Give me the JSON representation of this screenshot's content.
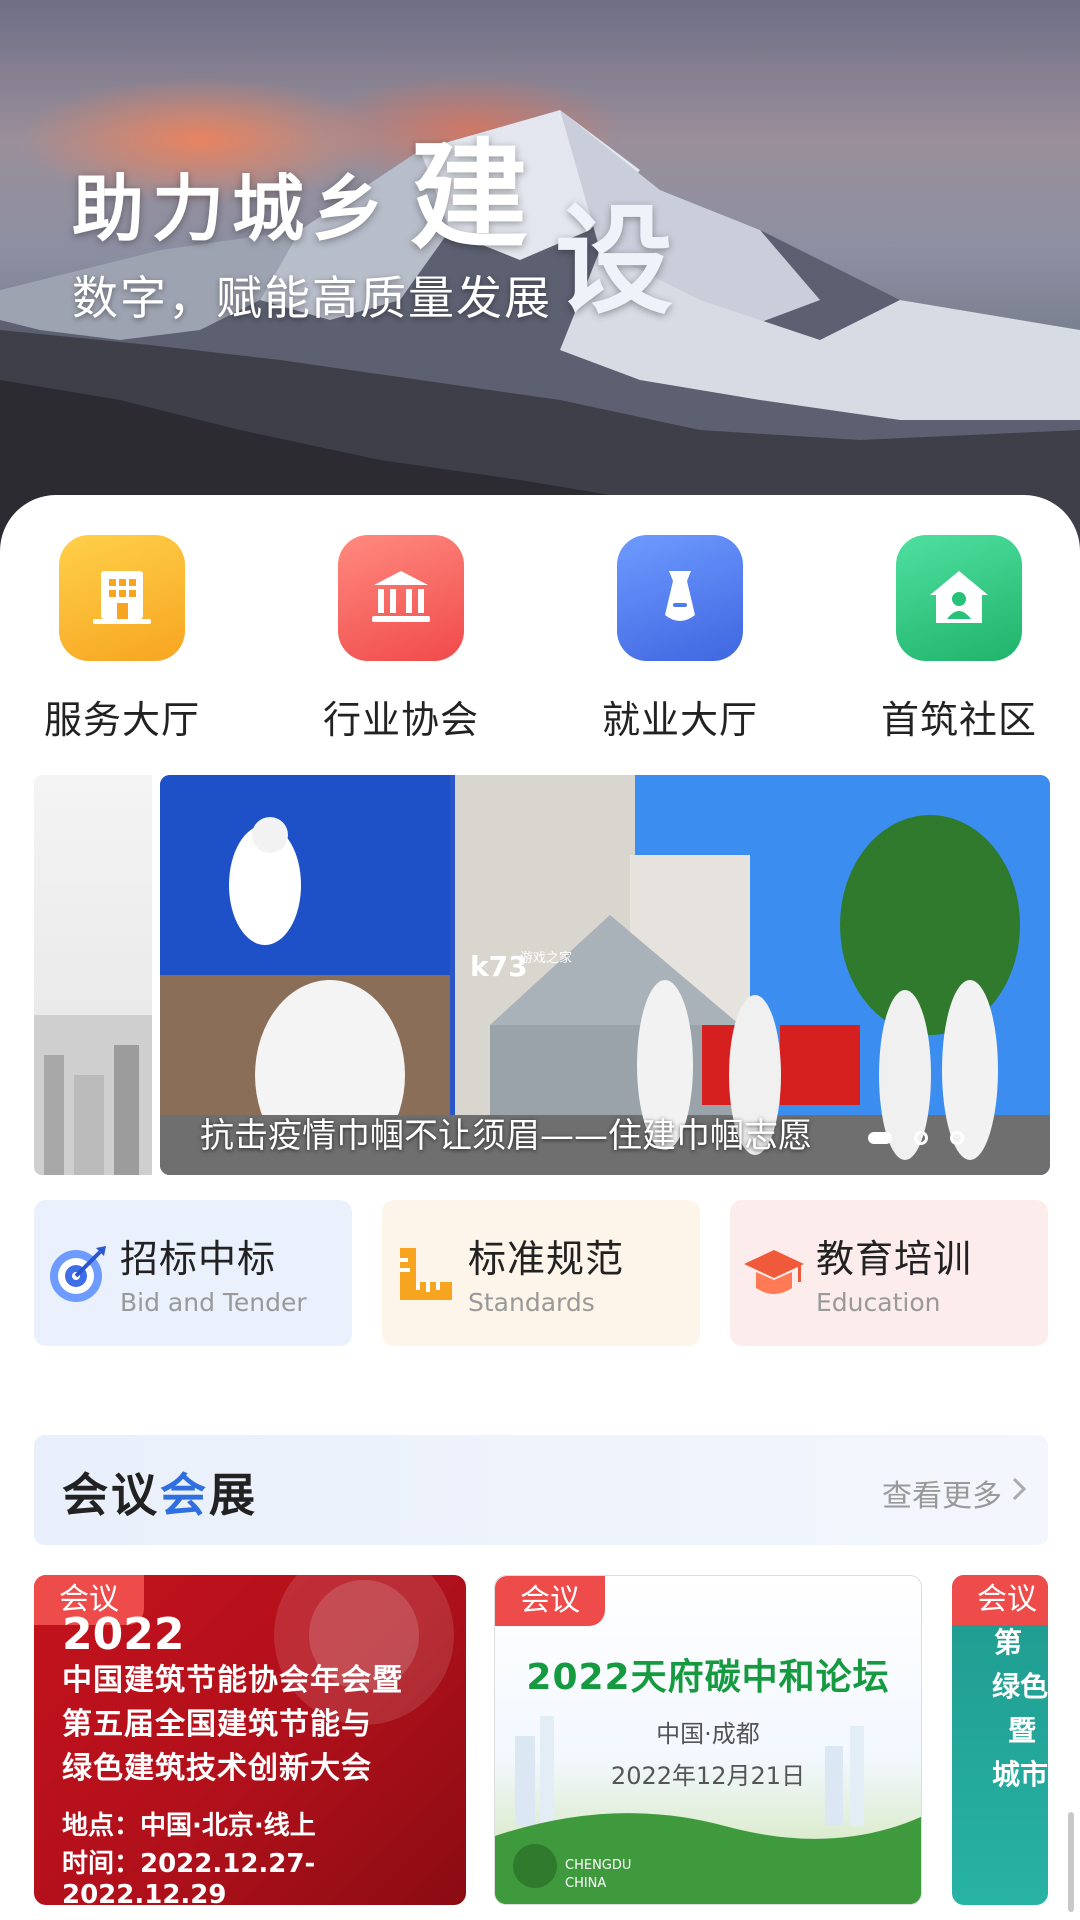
{
  "hero": {
    "title_part1": "助力城乡",
    "title_part2": "建",
    "title_part3": "设",
    "subtitle": "数字，赋能高质量发展"
  },
  "quick_nav": [
    {
      "label": "服务大厅",
      "icon": "building-icon",
      "color": "#f7a520"
    },
    {
      "label": "行业协会",
      "icon": "bank-icon",
      "color": "#f25a55"
    },
    {
      "label": "就业大厅",
      "icon": "tie-icon",
      "color": "#4d7cf0"
    },
    {
      "label": "首筑社区",
      "icon": "home-user-icon",
      "color": "#27c27a"
    }
  ],
  "banner": {
    "caption": "抗击疫情巾帼不让须眉——住建巾帼志愿",
    "watermark": "k73",
    "watermark_sub": "游戏之家",
    "dots_total": 3,
    "active_dot": 1
  },
  "features": [
    {
      "title": "招标中标",
      "subtitle": "Bid and Tender",
      "icon": "target-icon",
      "bg": "#eaf1fd"
    },
    {
      "title": "标准规范",
      "subtitle": "Standards",
      "icon": "ruler-icon",
      "bg": "#fdf4ea"
    },
    {
      "title": "教育培训",
      "subtitle": "Education",
      "icon": "graduation-cap-icon",
      "bg": "#fdecec"
    }
  ],
  "meetings_section": {
    "title_part1": "会议",
    "title_accent": "会",
    "title_part3": "展",
    "more_label": "查看更多"
  },
  "meetings": [
    {
      "badge": "会议",
      "year": "2022",
      "lines": [
        "中国建筑节能协会年会暨",
        "第五届全国建筑节能与",
        "绿色建筑技术创新大会"
      ],
      "place": "地点：中国·北京·线上",
      "time": "时间：2022.12.27-2022.12.29"
    },
    {
      "badge": "会议",
      "title": "2022天府碳中和论坛",
      "location": "中国·成都",
      "date": "2022年12月21日",
      "logo_text1": "CHENGDU",
      "logo_text2": "CHINA"
    },
    {
      "badge": "会议",
      "lines": [
        "第",
        "绿色",
        "暨",
        "城市"
      ]
    }
  ]
}
